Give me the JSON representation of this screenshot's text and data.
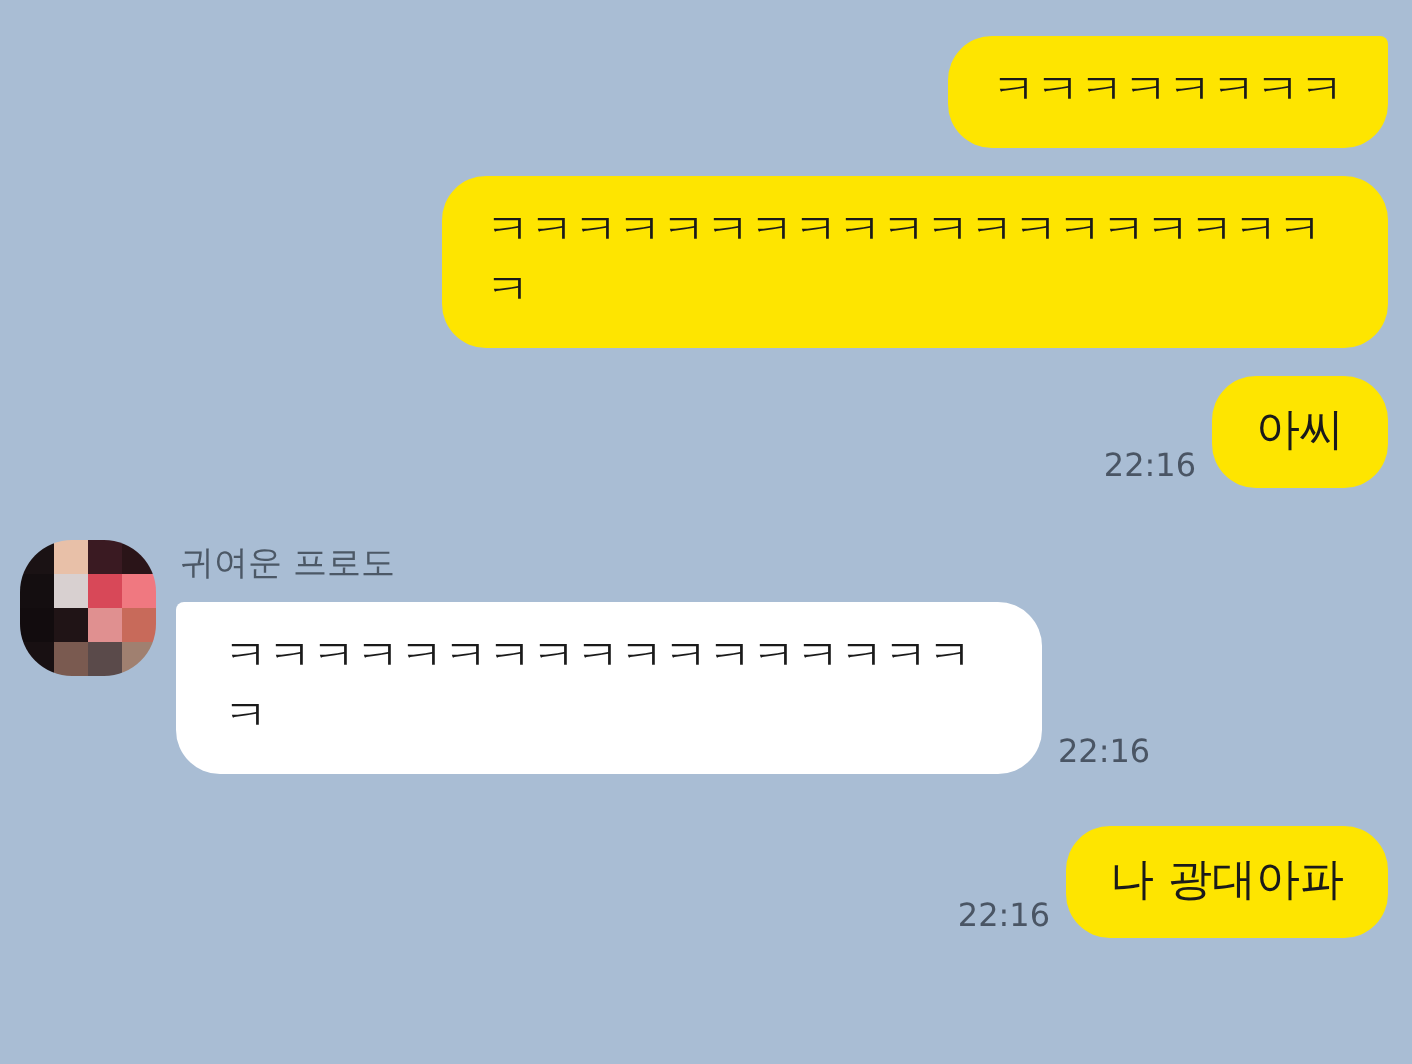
{
  "messages": [
    {
      "kind": "sent",
      "text": "ㅋㅋㅋㅋㅋㅋㅋㅋ",
      "tail": true
    },
    {
      "kind": "sent",
      "text": "ㅋㅋㅋㅋㅋㅋㅋㅋㅋㅋㅋㅋㅋㅋㅋㅋㅋㅋㅋㅋ",
      "tail": false
    },
    {
      "kind": "sent",
      "text": "아씨",
      "tail": false,
      "time": "22:16"
    },
    {
      "kind": "received",
      "sender": "귀여운 프로도",
      "text": "ㅋㅋㅋㅋㅋㅋㅋㅋㅋㅋㅋㅋㅋㅋㅋㅋㅋㅋ",
      "tail": true,
      "time": "22:16"
    },
    {
      "kind": "sent",
      "text": "나 광대아파",
      "tail": false,
      "time": "22:16"
    }
  ]
}
